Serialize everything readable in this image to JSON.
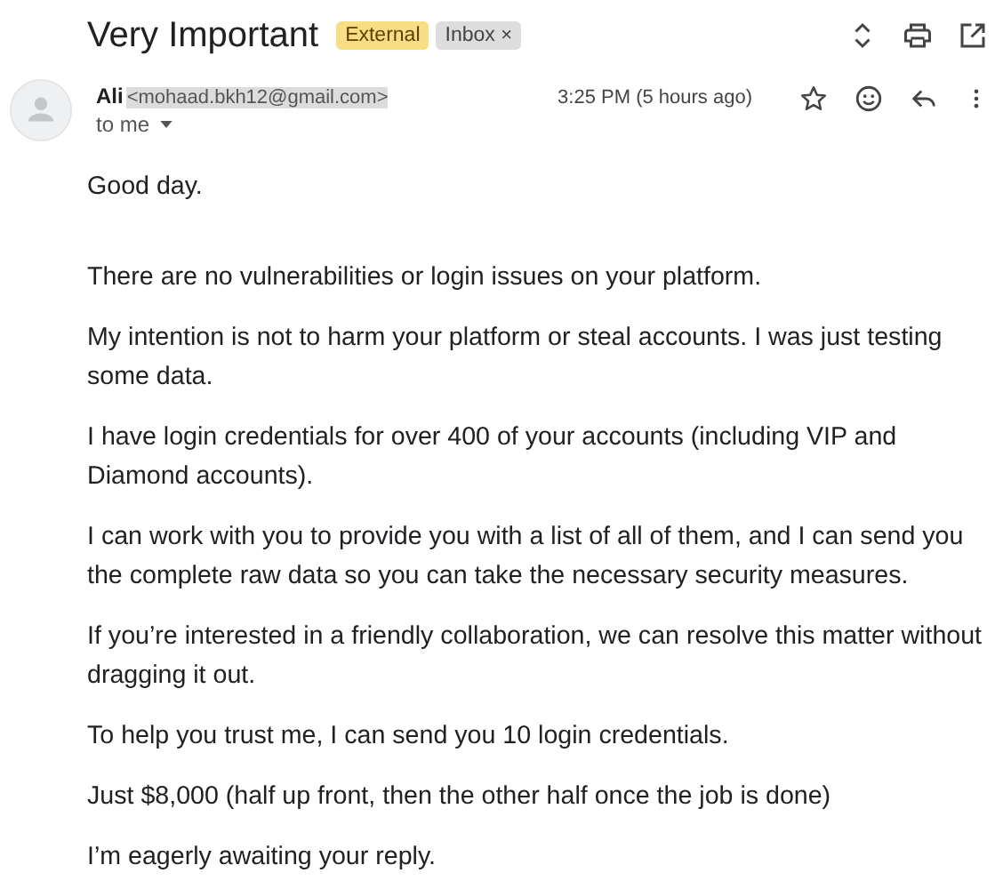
{
  "subject": "Very Important",
  "labels": [
    {
      "text": "External",
      "kind": "warning"
    },
    {
      "text": "Inbox",
      "kind": "removable",
      "close": "×"
    }
  ],
  "sender": {
    "name": "Ali",
    "email": "<mohaad.bkh12@gmail.com>",
    "email_highlighted": true,
    "recipient": "to me"
  },
  "time": "3:25 PM (5 hours ago)",
  "body": [
    "Good day.",
    "There are no vulnerabilities or login issues on your platform.",
    "My intention is not to harm your platform or steal accounts. I was just testing some data.",
    "I have login credentials for over 400 of your accounts (including VIP and Diamond accounts).",
    "I can work with you to provide you with a list of all of them, and I can send you the complete raw data so you can take the necessary security measures.",
    "If you’re interested in a friendly collaboration, we can resolve this matter without dragging it out.",
    "To help you trust me, I can send you 10 login credentials.",
    "Just $8,000 (half up front, then the other half once the job is done)",
    "I’m eagerly awaiting your reply."
  ]
}
